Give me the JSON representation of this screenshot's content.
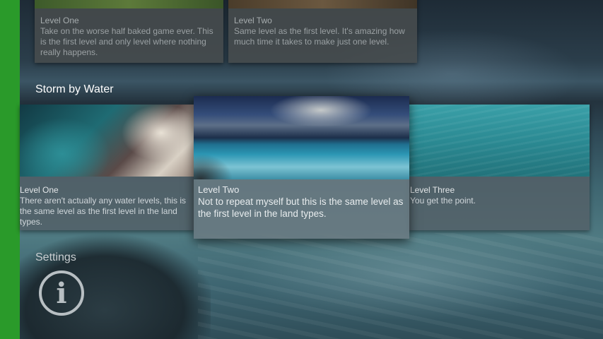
{
  "sections": {
    "land": {
      "cards": [
        {
          "title": "Level One",
          "description": "Take on the worse half baked game ever. This is the first level and only level where nothing really happens."
        },
        {
          "title": "Level Two",
          "description": "Same level as the first level. It's amazing how much time it takes to make just one level."
        }
      ]
    },
    "water": {
      "title": "Storm by Water",
      "cards": [
        {
          "title": "Level One",
          "description": "There aren't actually any water levels, this is the same level as the first level in the land types."
        },
        {
          "title": "Level Two",
          "description": "Not to repeat myself but this is the same level as the first level in the land types."
        },
        {
          "title": "Level Three",
          "description": "You get the point."
        }
      ]
    },
    "settings": {
      "title": "Settings",
      "info_icon": "info-circle-icon",
      "info_glyph": "i"
    }
  },
  "colors": {
    "side_bar": "#2a9a2a",
    "focused_card": "#6a7a82"
  }
}
